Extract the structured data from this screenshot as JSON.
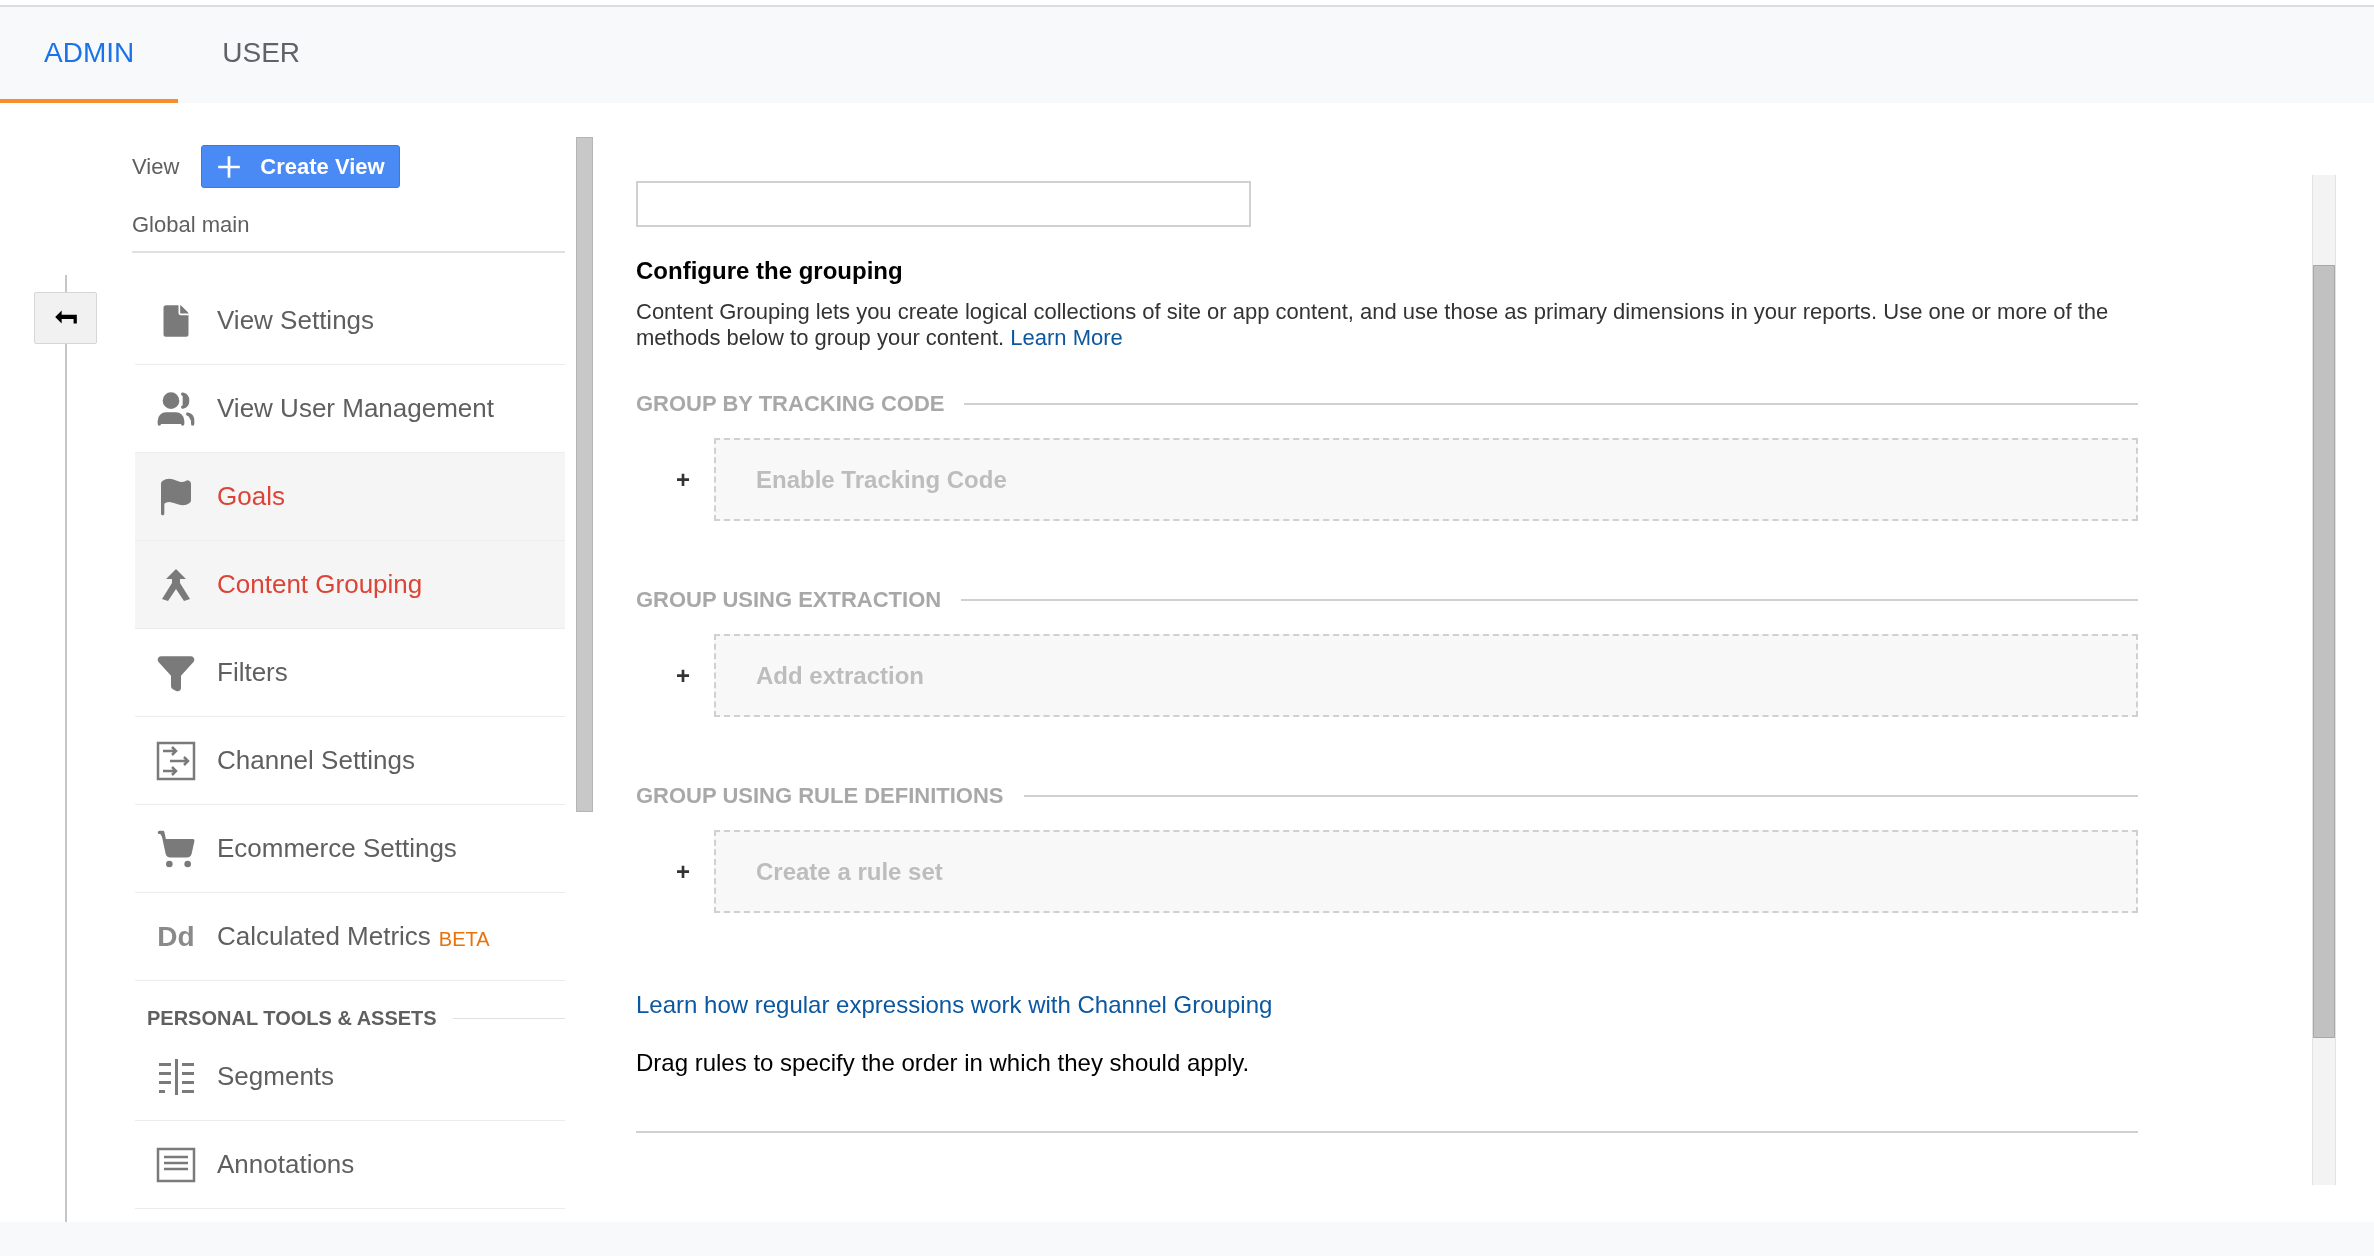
{
  "tabs": [
    {
      "label": "ADMIN",
      "selected": true
    },
    {
      "label": "USER",
      "selected": false
    }
  ],
  "sidebar": {
    "view_label": "View",
    "create_button": "Create View",
    "view_name": "Global main",
    "items": [
      {
        "label": "View Settings",
        "kind": "file",
        "selected": false
      },
      {
        "label": "View User Management",
        "kind": "users",
        "selected": false
      },
      {
        "label": "Goals",
        "kind": "flag",
        "selected": true
      },
      {
        "label": "Content Grouping",
        "kind": "merge",
        "selected": true
      },
      {
        "label": "Filters",
        "kind": "filter",
        "selected": false
      },
      {
        "label": "Channel Settings",
        "kind": "channel",
        "selected": false
      },
      {
        "label": "Ecommerce Settings",
        "kind": "cart",
        "selected": false
      },
      {
        "label": "Calculated Metrics",
        "kind": "text",
        "icon_text": "Dd",
        "badge": "BETA",
        "selected": false
      }
    ],
    "section_title": "PERSONAL TOOLS & ASSETS",
    "personal_items": [
      {
        "label": "Segments",
        "kind": "segments",
        "selected": false
      },
      {
        "label": "Annotations",
        "kind": "annotations",
        "selected": false
      }
    ]
  },
  "content": {
    "heading": "Configure the grouping",
    "description": "Content Grouping lets you create logical collections of site or app content, and use those as primary dimensions in your reports. Use one or more of the methods below to group your content.",
    "learn_more": "Learn More",
    "sections": [
      {
        "title": "GROUP BY TRACKING CODE",
        "add_symbol": "+",
        "action": "Enable Tracking Code"
      },
      {
        "title": "GROUP USING EXTRACTION",
        "add_symbol": "+",
        "action": "Add extraction"
      },
      {
        "title": "GROUP USING RULE DEFINITIONS",
        "add_symbol": "+",
        "action": "Create a rule set"
      }
    ],
    "regex_link": "Learn how regular expressions work with Channel Grouping",
    "drag_hint": "Drag rules to specify the order in which they should apply."
  }
}
